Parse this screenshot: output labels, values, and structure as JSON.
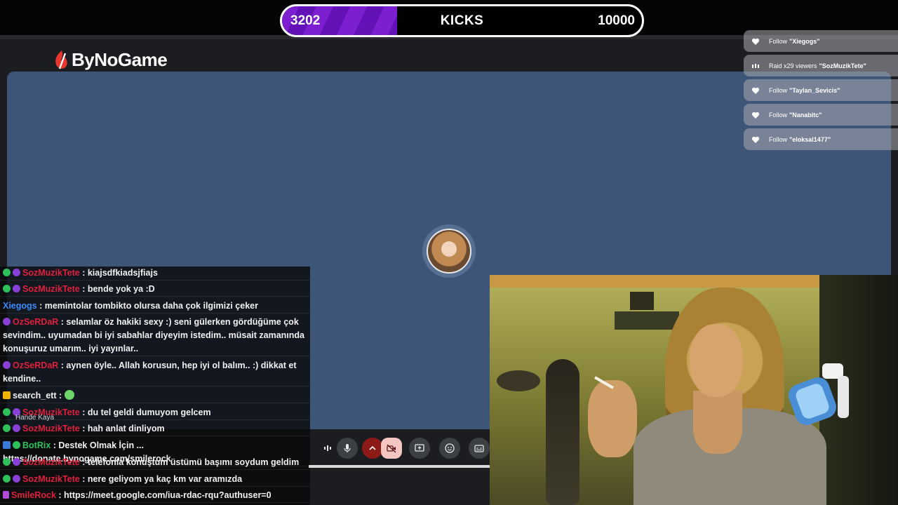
{
  "kicks": {
    "current": "3202",
    "label": "KICKS",
    "goal": "10000",
    "progress_fraction": 0.32
  },
  "brand": {
    "logo_text": "ByNoGame"
  },
  "meet": {
    "participant_name": "Hande Kaya"
  },
  "alerts": [
    {
      "icon": "heart-icon",
      "prefix": "Follow",
      "name": "\"Xiegogs\""
    },
    {
      "icon": "raid-icon",
      "prefix": "Raid x29 viewers",
      "name": "\"SozMuzikTete\""
    },
    {
      "icon": "heart-icon",
      "prefix": "Follow",
      "name": "\"Taylan_Sevicis\""
    },
    {
      "icon": "heart-icon",
      "prefix": "Follow",
      "name": "\"Nanabitc\""
    },
    {
      "icon": "heart-icon",
      "prefix": "Follow",
      "name": "\"eloksal1477\""
    }
  ],
  "chat": [
    {
      "badges": [
        "green",
        "purple"
      ],
      "user": "SozMuzikTete",
      "color": "#e0203c",
      "text": "kiajsdfkiadsjfiajs"
    },
    {
      "badges": [
        "green",
        "purple"
      ],
      "user": "SozMuzikTete",
      "color": "#e0203c",
      "text": "bende yok ya :D"
    },
    {
      "badges": [],
      "user": "Xiegogs",
      "color": "#3d8bfd",
      "text": "memintolar tombikto olursa daha çok ilgimizi çeker"
    },
    {
      "badges": [
        "purple"
      ],
      "user": "OzSeRDaR",
      "color": "#e0203c",
      "text": "selamlar öz hakiki sexy :) seni gülerken gördüğüme çok sevindim.. uyumadan bi iyi sabahlar diyeyim istedim.. müsait zamanında konuşuruz umarım.. iyi yayınlar.."
    },
    {
      "badges": [
        "purple"
      ],
      "user": "OzSeRDaR",
      "color": "#e0203c",
      "text": "aynen öyle.. Allah korusun, hep iyi ol balım.. :) dikkat et kendine.."
    },
    {
      "badges": [
        "yellow"
      ],
      "user": "search_ett",
      "color": "#f2f2f2",
      "text": "",
      "emote": true
    },
    {
      "badges": [
        "green",
        "purple"
      ],
      "user": "SozMuzikTete",
      "color": "#e0203c",
      "text": "du tel geldi dumuyom gelcem"
    },
    {
      "badges": [
        "green",
        "purple"
      ],
      "user": "SozMuzikTete",
      "color": "#e0203c",
      "text": "hah anlat dinliyom"
    },
    {
      "badges": [
        "blue",
        "green"
      ],
      "user": "BotRix",
      "color": "#2ec15a",
      "text": "Destek Olmak İçin ... https://donate.bynogame.com/smilerock"
    },
    {
      "badges": [
        "green",
        "purple"
      ],
      "user": "SozMuzikTete",
      "color": "#e0203c",
      "text": "telefonla konuştum üstümü başımı soydum geldim"
    },
    {
      "badges": [
        "green",
        "purple"
      ],
      "user": "SozMuzikTete",
      "color": "#e0203c",
      "text": "nere geliyom ya kaç km var aramızda"
    },
    {
      "badges": [
        "mod"
      ],
      "user": "SmileRock",
      "color": "#e0203c",
      "text": "https://meet.google.com/iua-rdac-rqu?authuser=0"
    }
  ],
  "controls": [
    "audio-levels-icon",
    "microphone-icon",
    "chevron-up-icon",
    "camera-off-icon",
    "present-screen-icon",
    "emoji-icon",
    "captions-icon"
  ]
}
